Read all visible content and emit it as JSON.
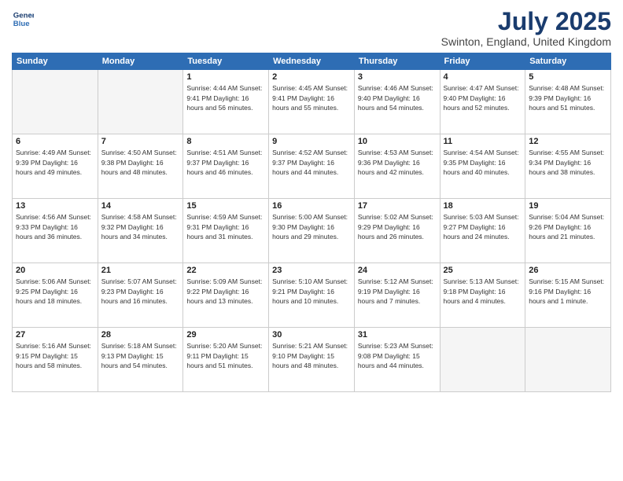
{
  "header": {
    "logo_line1": "General",
    "logo_line2": "Blue",
    "main_title": "July 2025",
    "subtitle": "Swinton, England, United Kingdom"
  },
  "weekdays": [
    "Sunday",
    "Monday",
    "Tuesday",
    "Wednesday",
    "Thursday",
    "Friday",
    "Saturday"
  ],
  "weeks": [
    [
      {
        "day": "",
        "info": ""
      },
      {
        "day": "",
        "info": ""
      },
      {
        "day": "1",
        "info": "Sunrise: 4:44 AM\nSunset: 9:41 PM\nDaylight: 16 hours and 56 minutes."
      },
      {
        "day": "2",
        "info": "Sunrise: 4:45 AM\nSunset: 9:41 PM\nDaylight: 16 hours and 55 minutes."
      },
      {
        "day": "3",
        "info": "Sunrise: 4:46 AM\nSunset: 9:40 PM\nDaylight: 16 hours and 54 minutes."
      },
      {
        "day": "4",
        "info": "Sunrise: 4:47 AM\nSunset: 9:40 PM\nDaylight: 16 hours and 52 minutes."
      },
      {
        "day": "5",
        "info": "Sunrise: 4:48 AM\nSunset: 9:39 PM\nDaylight: 16 hours and 51 minutes."
      }
    ],
    [
      {
        "day": "6",
        "info": "Sunrise: 4:49 AM\nSunset: 9:39 PM\nDaylight: 16 hours and 49 minutes."
      },
      {
        "day": "7",
        "info": "Sunrise: 4:50 AM\nSunset: 9:38 PM\nDaylight: 16 hours and 48 minutes."
      },
      {
        "day": "8",
        "info": "Sunrise: 4:51 AM\nSunset: 9:37 PM\nDaylight: 16 hours and 46 minutes."
      },
      {
        "day": "9",
        "info": "Sunrise: 4:52 AM\nSunset: 9:37 PM\nDaylight: 16 hours and 44 minutes."
      },
      {
        "day": "10",
        "info": "Sunrise: 4:53 AM\nSunset: 9:36 PM\nDaylight: 16 hours and 42 minutes."
      },
      {
        "day": "11",
        "info": "Sunrise: 4:54 AM\nSunset: 9:35 PM\nDaylight: 16 hours and 40 minutes."
      },
      {
        "day": "12",
        "info": "Sunrise: 4:55 AM\nSunset: 9:34 PM\nDaylight: 16 hours and 38 minutes."
      }
    ],
    [
      {
        "day": "13",
        "info": "Sunrise: 4:56 AM\nSunset: 9:33 PM\nDaylight: 16 hours and 36 minutes."
      },
      {
        "day": "14",
        "info": "Sunrise: 4:58 AM\nSunset: 9:32 PM\nDaylight: 16 hours and 34 minutes."
      },
      {
        "day": "15",
        "info": "Sunrise: 4:59 AM\nSunset: 9:31 PM\nDaylight: 16 hours and 31 minutes."
      },
      {
        "day": "16",
        "info": "Sunrise: 5:00 AM\nSunset: 9:30 PM\nDaylight: 16 hours and 29 minutes."
      },
      {
        "day": "17",
        "info": "Sunrise: 5:02 AM\nSunset: 9:29 PM\nDaylight: 16 hours and 26 minutes."
      },
      {
        "day": "18",
        "info": "Sunrise: 5:03 AM\nSunset: 9:27 PM\nDaylight: 16 hours and 24 minutes."
      },
      {
        "day": "19",
        "info": "Sunrise: 5:04 AM\nSunset: 9:26 PM\nDaylight: 16 hours and 21 minutes."
      }
    ],
    [
      {
        "day": "20",
        "info": "Sunrise: 5:06 AM\nSunset: 9:25 PM\nDaylight: 16 hours and 18 minutes."
      },
      {
        "day": "21",
        "info": "Sunrise: 5:07 AM\nSunset: 9:23 PM\nDaylight: 16 hours and 16 minutes."
      },
      {
        "day": "22",
        "info": "Sunrise: 5:09 AM\nSunset: 9:22 PM\nDaylight: 16 hours and 13 minutes."
      },
      {
        "day": "23",
        "info": "Sunrise: 5:10 AM\nSunset: 9:21 PM\nDaylight: 16 hours and 10 minutes."
      },
      {
        "day": "24",
        "info": "Sunrise: 5:12 AM\nSunset: 9:19 PM\nDaylight: 16 hours and 7 minutes."
      },
      {
        "day": "25",
        "info": "Sunrise: 5:13 AM\nSunset: 9:18 PM\nDaylight: 16 hours and 4 minutes."
      },
      {
        "day": "26",
        "info": "Sunrise: 5:15 AM\nSunset: 9:16 PM\nDaylight: 16 hours and 1 minute."
      }
    ],
    [
      {
        "day": "27",
        "info": "Sunrise: 5:16 AM\nSunset: 9:15 PM\nDaylight: 15 hours and 58 minutes."
      },
      {
        "day": "28",
        "info": "Sunrise: 5:18 AM\nSunset: 9:13 PM\nDaylight: 15 hours and 54 minutes."
      },
      {
        "day": "29",
        "info": "Sunrise: 5:20 AM\nSunset: 9:11 PM\nDaylight: 15 hours and 51 minutes."
      },
      {
        "day": "30",
        "info": "Sunrise: 5:21 AM\nSunset: 9:10 PM\nDaylight: 15 hours and 48 minutes."
      },
      {
        "day": "31",
        "info": "Sunrise: 5:23 AM\nSunset: 9:08 PM\nDaylight: 15 hours and 44 minutes."
      },
      {
        "day": "",
        "info": ""
      },
      {
        "day": "",
        "info": ""
      }
    ]
  ]
}
